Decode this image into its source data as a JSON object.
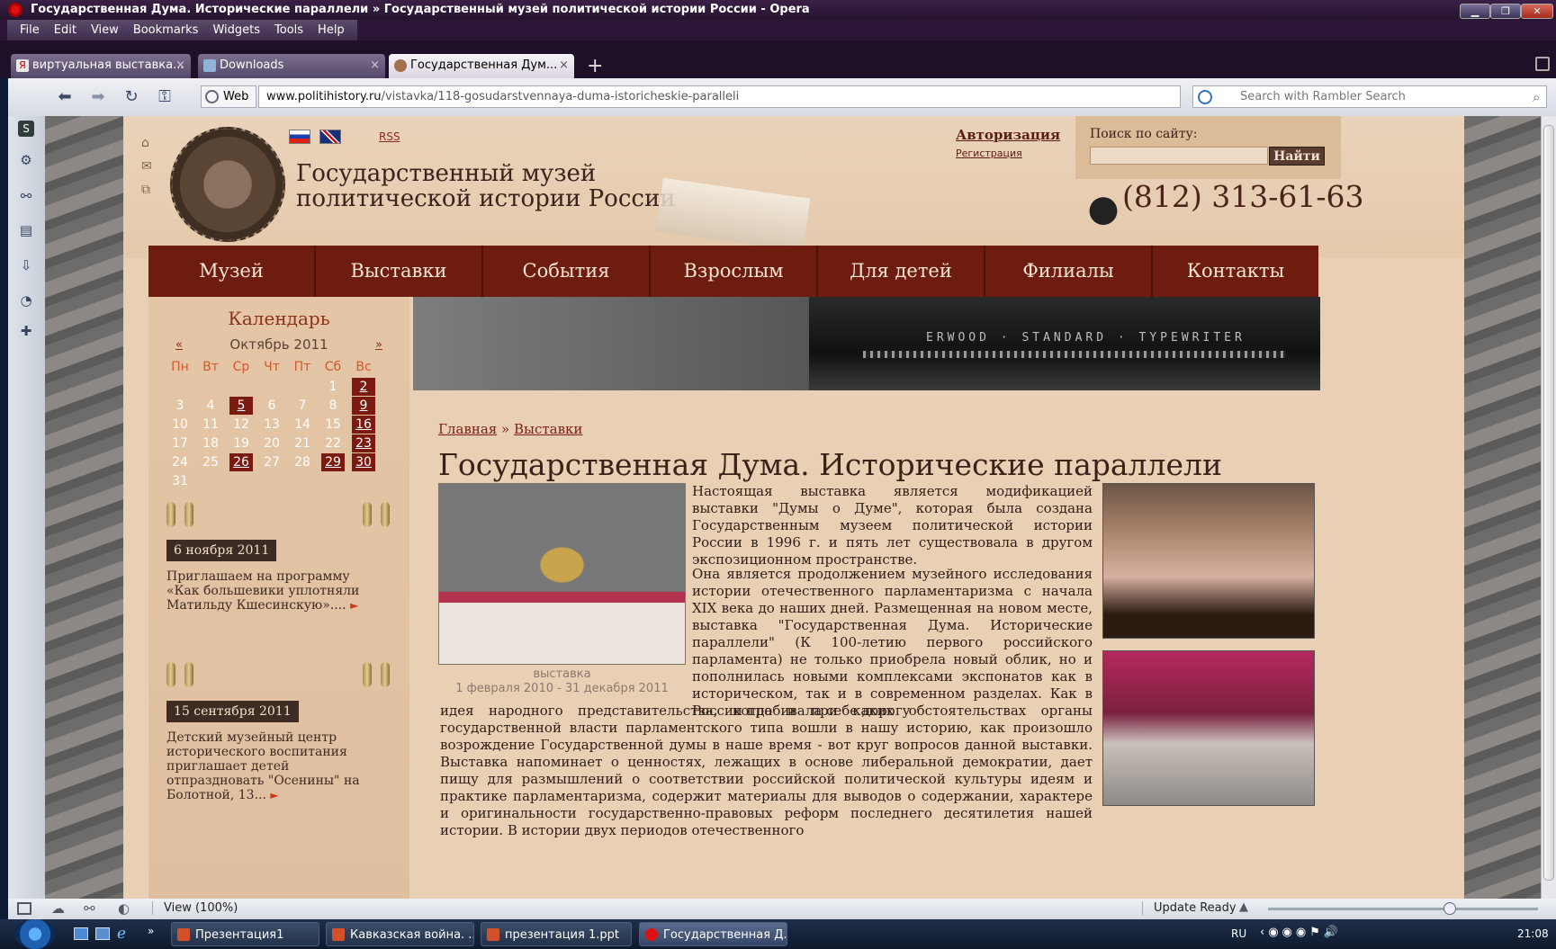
{
  "window": {
    "title": "Государственная Дума. Исторические параллели » Государственный музей политической истории России - Opera",
    "menu": [
      "File",
      "Edit",
      "View",
      "Bookmarks",
      "Widgets",
      "Tools",
      "Help"
    ]
  },
  "tabs": [
    {
      "label": "виртуальная выставка...",
      "close": "×"
    },
    {
      "label": "Downloads",
      "close": "×"
    },
    {
      "label": "Государственная Дум...",
      "close": "×",
      "active": true
    }
  ],
  "new_tab": "+",
  "navigation": {
    "web_label": "Web",
    "url_host": "www.politihistory.ru",
    "url_path": "/vistavka/118-gosudarstvennaya-duma-istoricheskie-paralleli",
    "search_placeholder": "Search with Rambler Search"
  },
  "site": {
    "museum_name_line1": "Государственный музей",
    "museum_name_line2": "политической истории России",
    "rss": "RSS",
    "auth": "Авторизация",
    "register": "Регистрация",
    "search_label": "Поиск по сайту:",
    "search_button": "Найти",
    "phone": "(812) 313-61-63",
    "nav": [
      "Музей",
      "Выставки",
      "События",
      "Взрослым",
      "Для детей",
      "Филиалы",
      "Контакты"
    ]
  },
  "calendar": {
    "title": "Календарь",
    "month": "Октябрь 2011",
    "prev": "«",
    "next": "»",
    "weekdays": [
      "Пн",
      "Вт",
      "Ср",
      "Чт",
      "Пт",
      "Сб",
      "Вс"
    ],
    "weeks": [
      [
        "",
        "",
        "",
        "",
        "",
        "1",
        "2"
      ],
      [
        "3",
        "4",
        "5",
        "6",
        "7",
        "8",
        "9"
      ],
      [
        "10",
        "11",
        "12",
        "13",
        "14",
        "15",
        "16"
      ],
      [
        "17",
        "18",
        "19",
        "20",
        "21",
        "22",
        "23"
      ],
      [
        "24",
        "25",
        "26",
        "27",
        "28",
        "29",
        "30"
      ],
      [
        "31",
        "",
        "",
        "",
        "",
        "",
        ""
      ]
    ],
    "event_days": [
      "2",
      "5",
      "9",
      "16",
      "23",
      "26",
      "29",
      "30"
    ]
  },
  "news": [
    {
      "date": "6 ноября 2011",
      "text": "Приглашаем на программу «Как большевики уплотняли Матильду Кшесинскую»...."
    },
    {
      "date": "15 сентября 2011",
      "text": "Детский музейный центр исторического воспитания приглашает детей отпраздновать \"Осенины\" на Болотной, 13..."
    }
  ],
  "banner_text": "ERWOOD · STANDARD · TYPEWRITER",
  "content": {
    "breadcrumb_home": "Главная",
    "breadcrumb_sep": " » ",
    "breadcrumb_current": "Выставки",
    "title": "Государственная Дума. Исторические параллели",
    "caption_line1": "выставка",
    "caption_line2": "1 февраля 2010 - 31 декабря 2011",
    "para1": "Настоящая выставка является модификацией выставки \"Думы о Думе\", которая была создана Государственным музеем политической истории России в 1996 г. и пять лет существовала в другом экспозиционном пространстве.",
    "para2a": "Она является продолжением музейного исследования истории отечественного парламентаризма с начала XIX века до наших дней. Размещенная на новом месте, выставка \"Государственная Дума. Исторические параллели\" (К 100-летию первого российского парламента) не только приобрела новый облик, но и пополнилась новыми комплексами экспонатов как в историческом, так и в современном разделах. Как в России пробивала себе дорогу",
    "para2b": "идея народного представительства, когда и при каких обстоятельствах органы государственной власти парламентского типа вошли в нашу историю, как произошло возрождение Государственной думы в наше время - вот круг вопросов данной выставки. Выставка напоминает о ценностях, лежащих в основе либеральной демократии, дает пищу для размышлений о соответствии российской политической культуры идеям и практике парламентаризма, содержит материалы для выводов о содержании, характере и оригинальности государственно-правовых реформ последнего десятилетия нашей истории. В истории двух периодов отечественного"
  },
  "status": {
    "view": "View (100%)",
    "update": "Update Ready"
  },
  "taskbar": {
    "items": [
      "Презентация1",
      "Кавказская война. ...",
      "презентация 1.ppt",
      "Государственная Д..."
    ],
    "lang": "RU",
    "time": "21:08"
  }
}
